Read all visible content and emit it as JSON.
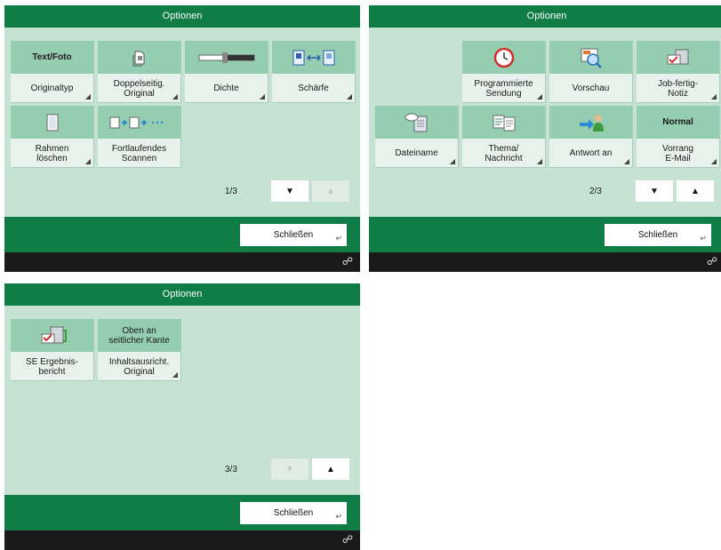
{
  "colors": {
    "title_bar": "#0f7d45",
    "panel_background": "#c5e2d2",
    "button_header": "#95cdb1",
    "button_body": "#e8f2ec",
    "status_bar": "#1a1a1a"
  },
  "panels": [
    {
      "title": "Optionen",
      "page_indicator": "1/3",
      "close_label": "Schließen",
      "status_icon": "status-monitor-icon",
      "nav": {
        "down_enabled": true,
        "up_enabled": false
      },
      "buttons": [
        {
          "header_text": "Text/Foto",
          "label": "Originaltyp",
          "icon": null
        },
        {
          "header_text": null,
          "label": "Doppelseitig.\nOriginal",
          "icon": "two-sided-original-icon"
        },
        {
          "header_text": null,
          "label": "Dichte",
          "icon": "density-slider-icon"
        },
        {
          "header_text": null,
          "label": "Schärfe",
          "icon": "sharpness-icon"
        },
        {
          "header_text": null,
          "label": "Rahmen\nlöschen",
          "icon": "erase-frame-icon"
        },
        {
          "header_text": null,
          "label": "Fortlaufendes\nScannen",
          "icon": "continuous-scan-icon"
        }
      ]
    },
    {
      "title": "Optionen",
      "page_indicator": "2/3",
      "close_label": "Schließen",
      "status_icon": "status-monitor-icon",
      "nav": {
        "down_enabled": true,
        "up_enabled": true
      },
      "buttons": [
        {
          "header_text": null,
          "label": "Programmierte\nSendung",
          "icon": "clock-icon"
        },
        {
          "header_text": null,
          "label": "Vorschau",
          "icon": "preview-icon"
        },
        {
          "header_text": null,
          "label": "Job-fertig-\nNotiz",
          "icon": "job-done-notice-icon"
        },
        {
          "header_text": null,
          "label": "Dateiname",
          "icon": "file-name-icon"
        },
        {
          "header_text": null,
          "label": "Thema/\nNachricht",
          "icon": "subject-message-icon"
        },
        {
          "header_text": null,
          "label": "Antwort an",
          "icon": "reply-to-icon"
        },
        {
          "header_text": "Normal",
          "label": "Vorrang\nE-Mail",
          "icon": null
        }
      ]
    },
    {
      "title": "Optionen",
      "page_indicator": "3/3",
      "close_label": "Schließen",
      "status_icon": "status-monitor-icon",
      "nav": {
        "down_enabled": false,
        "up_enabled": true
      },
      "buttons": [
        {
          "header_text": null,
          "label": "SE Ergebnis-\nbericht",
          "icon": "tx-report-icon"
        },
        {
          "header_text": "Oben an\nseitlicher Kante",
          "label": "Inhaltsausricht.\nOriginal",
          "icon": null
        }
      ]
    }
  ]
}
